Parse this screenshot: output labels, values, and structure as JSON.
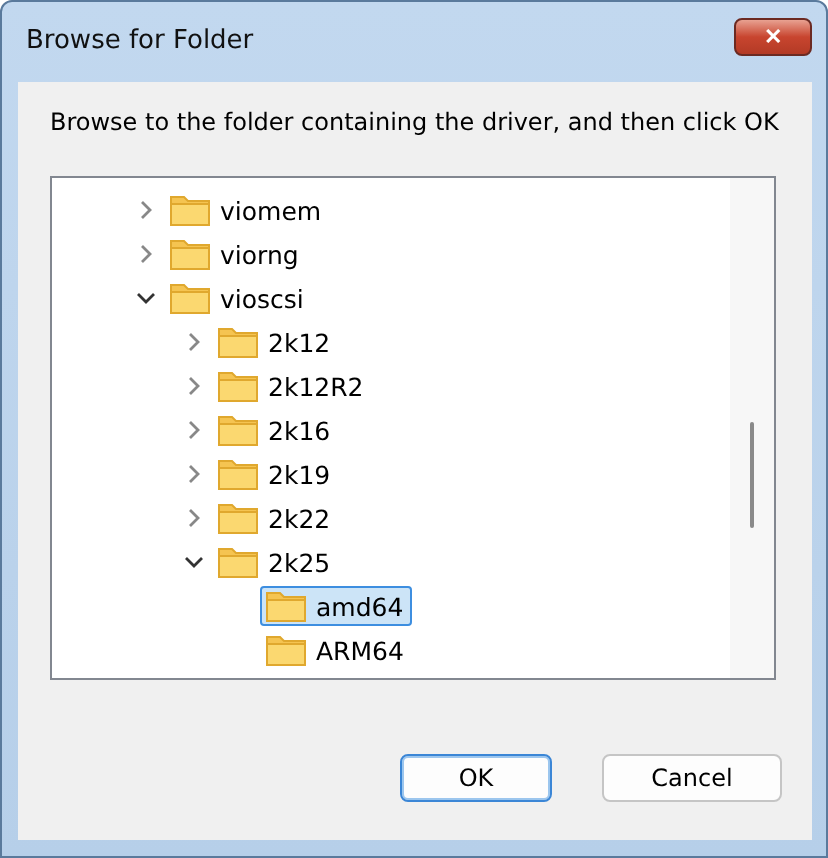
{
  "window": {
    "title": "Browse for Folder",
    "close": "✕"
  },
  "instruction": "Browse to the folder containing the driver, and then click OK",
  "tree": [
    {
      "label": "viomem",
      "expanded": false,
      "selected": false
    },
    {
      "label": "viorng",
      "expanded": false,
      "selected": false
    },
    {
      "label": "vioscsi",
      "expanded": true,
      "selected": false,
      "children": [
        {
          "label": "2k12",
          "expanded": false,
          "selected": false
        },
        {
          "label": "2k12R2",
          "expanded": false,
          "selected": false
        },
        {
          "label": "2k16",
          "expanded": false,
          "selected": false
        },
        {
          "label": "2k19",
          "expanded": false,
          "selected": false
        },
        {
          "label": "2k22",
          "expanded": false,
          "selected": false
        },
        {
          "label": "2k25",
          "expanded": true,
          "selected": false,
          "children": [
            {
              "label": "amd64",
              "selected": true
            },
            {
              "label": "ARM64",
              "selected": false
            }
          ]
        }
      ]
    }
  ],
  "buttons": [
    {
      "label": "OK",
      "default": true
    },
    {
      "label": "Cancel",
      "default": false
    }
  ]
}
